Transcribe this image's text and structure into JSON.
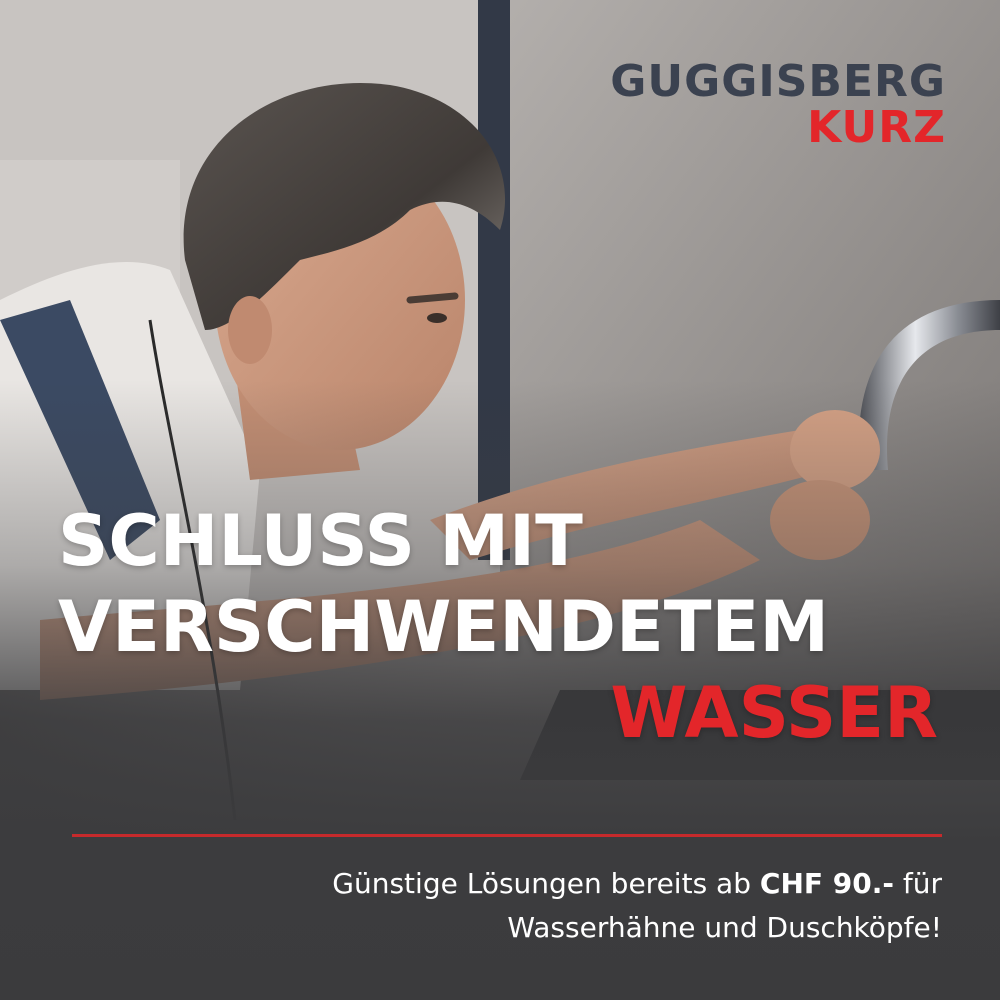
{
  "logo": {
    "line1": "GUGGISBERG",
    "line2": "KURZ"
  },
  "headline": {
    "line1": "SCHLUSS MIT",
    "line2": "VERSCHWENDETEM",
    "line3": "WASSER"
  },
  "subline": {
    "part1": "Günstige Lösungen bereits ab ",
    "price": "CHF 90.-",
    "part2": " für",
    "line2": "Wasserhähne und Duschköpfe!"
  },
  "colors": {
    "accent": "#e3262a",
    "logo_dark": "#3b4250",
    "background": "#3c3c3e"
  },
  "image": {
    "subject": "plumber-installing-faucet-photo"
  }
}
